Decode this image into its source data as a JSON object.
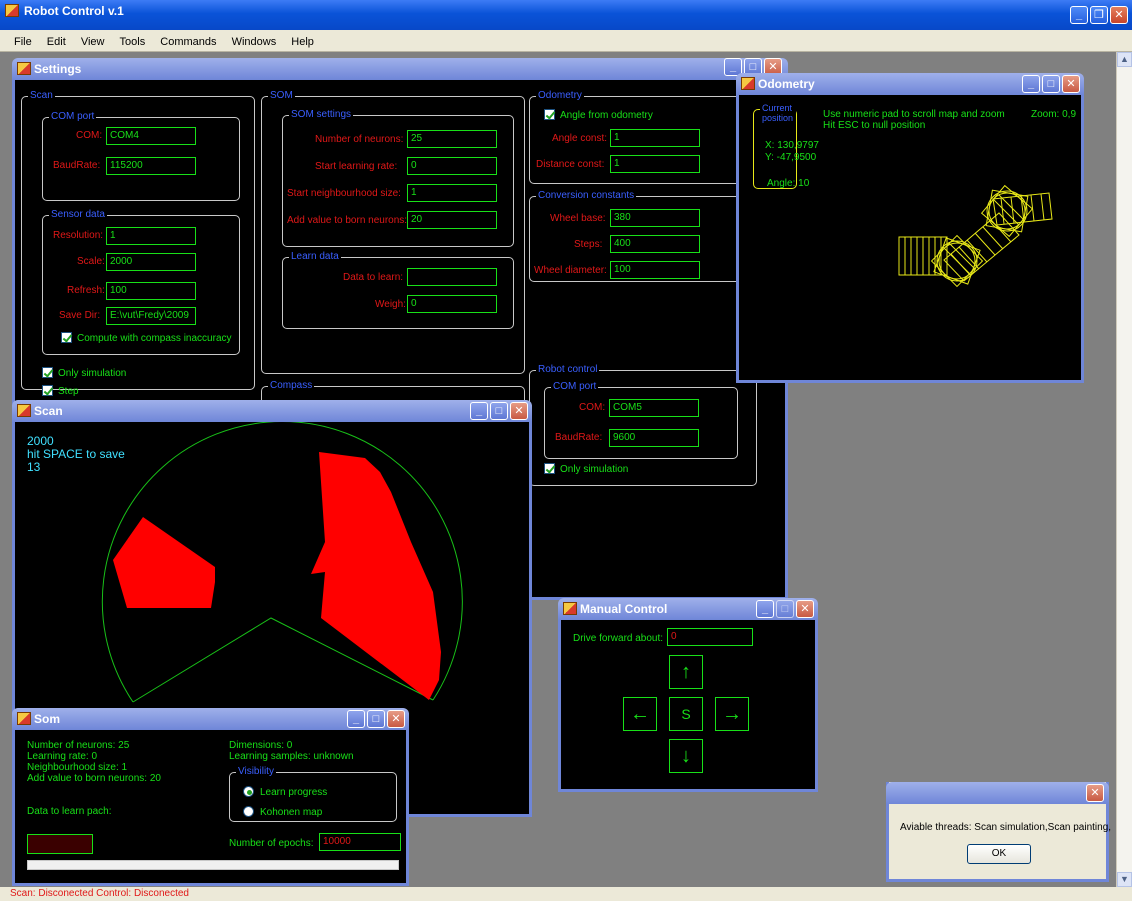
{
  "app": {
    "title": "Robot Control v.1"
  },
  "menu": [
    "File",
    "Edit",
    "View",
    "Tools",
    "Commands",
    "Windows",
    "Help"
  ],
  "settings": {
    "title": "Settings",
    "scan": {
      "group": "Scan",
      "com_group": "COM port",
      "com_label": "COM:",
      "com_value": "COM4",
      "baud_label": "BaudRate:",
      "baud_value": "115200",
      "sensor_group": "Sensor data",
      "resolution_label": "Resolution:",
      "resolution_value": "1",
      "scale_label": "Scale:",
      "scale_value": "2000",
      "refresh_label": "Refresh:",
      "refresh_value": "100",
      "savedir_label": "Save Dir:",
      "savedir_value": "E:\\vut\\Fredy\\2009",
      "compass_check": "Compute with compass inaccuracy",
      "only_sim": "Only simulation",
      "step": "Step"
    },
    "som": {
      "group": "SOM",
      "settings_group": "SOM settings",
      "neurons_label": "Number of neurons:",
      "neurons_value": "25",
      "rate_label": "Start learning rate:",
      "rate_value": "0",
      "neigh_label": "Start neighbourhood size:",
      "neigh_value": "1",
      "addval_label": "Add value to born neurons:",
      "addval_value": "20",
      "learn_group": "Learn data",
      "data_label": "Data to learn:",
      "data_value": "",
      "weigh_label": "Weigh:",
      "weigh_value": "0",
      "compass_group": "Compass"
    },
    "odometry": {
      "group": "Odometry",
      "angle_check": "Angle from odometry",
      "angle_const_label": "Angle const:",
      "angle_const_value": "1",
      "dist_const_label": "Distance const:",
      "dist_const_value": "1",
      "conv_group": "Conversion constants",
      "wheelbase_label": "Wheel base:",
      "wheelbase_value": "380",
      "steps_label": "Steps:",
      "steps_value": "400",
      "wheeldiam_label": "Wheel diameter:",
      "wheeldiam_value": "100"
    },
    "robot": {
      "group": "Robot control",
      "com_group": "COM port",
      "com_label": "COM:",
      "com_value": "COM5",
      "baud_label": "BaudRate:",
      "baud_value": "9600",
      "only_sim": "Only simulation"
    }
  },
  "odometry_win": {
    "title": "Odometry",
    "pos_group": "Current position",
    "x": "X: 130,9797",
    "y": "Y: -47,9500",
    "angle": "Angle: 10",
    "hint1": "Use numeric pad to scroll map and zoom",
    "hint2": "Hit ESC to null position",
    "zoom": "Zoom: 0,9"
  },
  "scan_win": {
    "title": "Scan",
    "line1": "2000",
    "line2": "hit SPACE to save",
    "line3": "13",
    "colors": {
      "scan": "#ff0000",
      "range": "#18c018"
    }
  },
  "manual": {
    "title": "Manual Control",
    "drive_label": "Drive forward about:",
    "drive_value": "0",
    "stop": "S",
    "up": "↑",
    "down": "↓",
    "left": "←",
    "right": "→"
  },
  "som_win": {
    "title": "Som",
    "neurons": "Number of neurons: 25",
    "rate": "Learning rate: 0",
    "neigh": "Neighbourhood size: 1",
    "addval": "Add value to born neurons: 20",
    "dimensions": "Dimensions: 0",
    "samples": "Learning samples: unknown",
    "vis_group": "Visibility",
    "learn_progress": "Learn progress",
    "kohonen": "Kohonen map",
    "data_path": "Data to learn pach:",
    "epochs_label": "Number of epochs:",
    "epochs_value": "10000"
  },
  "dialog": {
    "message": "Aviable threads: Scan simulation,Scan painting,",
    "ok": "OK"
  },
  "status": "Scan: Disconected  Control: Disconected"
}
